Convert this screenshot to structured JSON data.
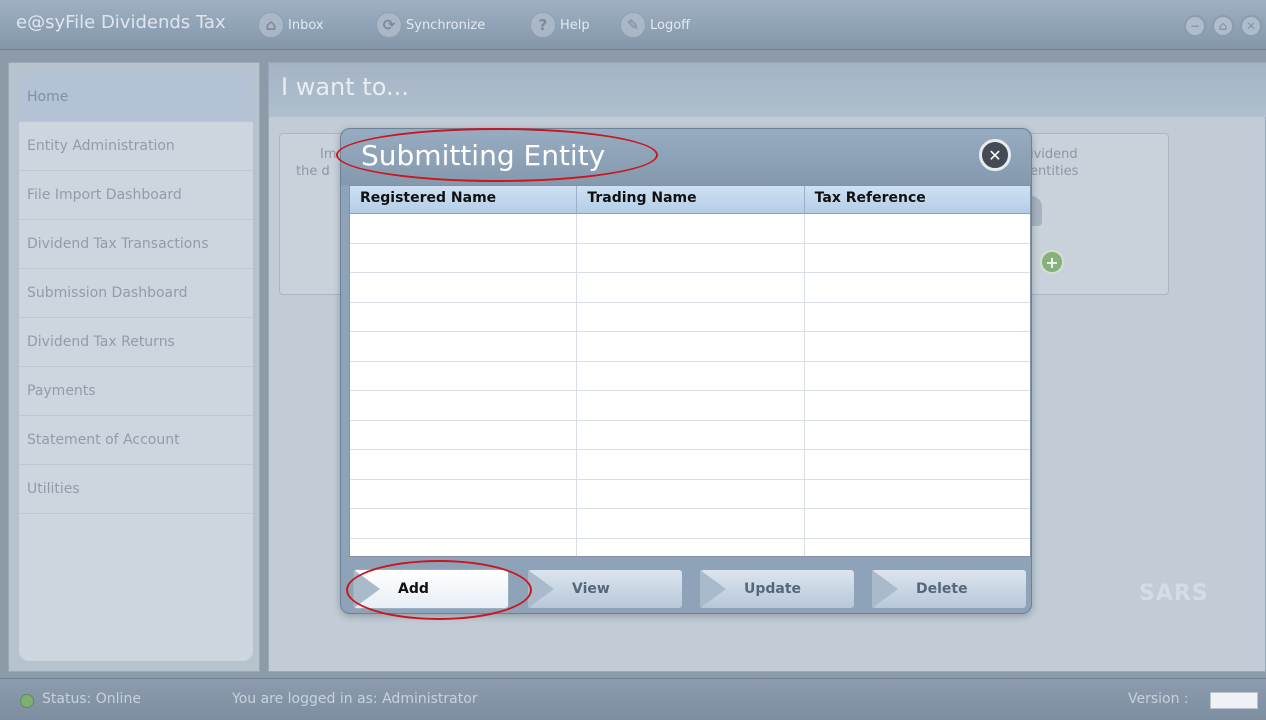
{
  "app": {
    "title": "e@syFile Dividends Tax"
  },
  "toolbar": {
    "inbox": "Inbox",
    "synchronize": "Synchronize",
    "help": "Help",
    "logoff": "Logoff"
  },
  "window_controls": {
    "minimize": "−",
    "restore": "⌂",
    "close": "✕"
  },
  "sidebar": {
    "items": [
      {
        "label": "Home"
      },
      {
        "label": "Entity Administration"
      },
      {
        "label": "File Import Dashboard"
      },
      {
        "label": "Dividend Tax Transactions"
      },
      {
        "label": "Submission Dashboard"
      },
      {
        "label": "Dividend Tax Returns"
      },
      {
        "label": "Payments"
      },
      {
        "label": "Statement of Account"
      },
      {
        "label": "Utilities"
      }
    ]
  },
  "main": {
    "title": "I want to...",
    "card_left": {
      "line1": "Im",
      "line2": "the d"
    },
    "card_right": {
      "line1": "ividend",
      "line2": "entities"
    },
    "brand": "SARS"
  },
  "modal": {
    "title": "Submitting Entity",
    "columns": [
      "Registered Name",
      "Trading Name",
      "Tax Reference"
    ],
    "buttons": {
      "add": "Add",
      "view": "View",
      "update": "Update",
      "delete": "Delete"
    }
  },
  "status": {
    "state": "Status: Online",
    "login": "You are logged in as: Administrator",
    "version_label": "Version :"
  },
  "colors": {
    "annotation": "#c9161f",
    "online": "#7fae73"
  },
  "icons": {
    "inbox": "inbox-icon",
    "synchronize": "sync-icon",
    "help": "help-icon",
    "logoff": "logoff-icon"
  }
}
